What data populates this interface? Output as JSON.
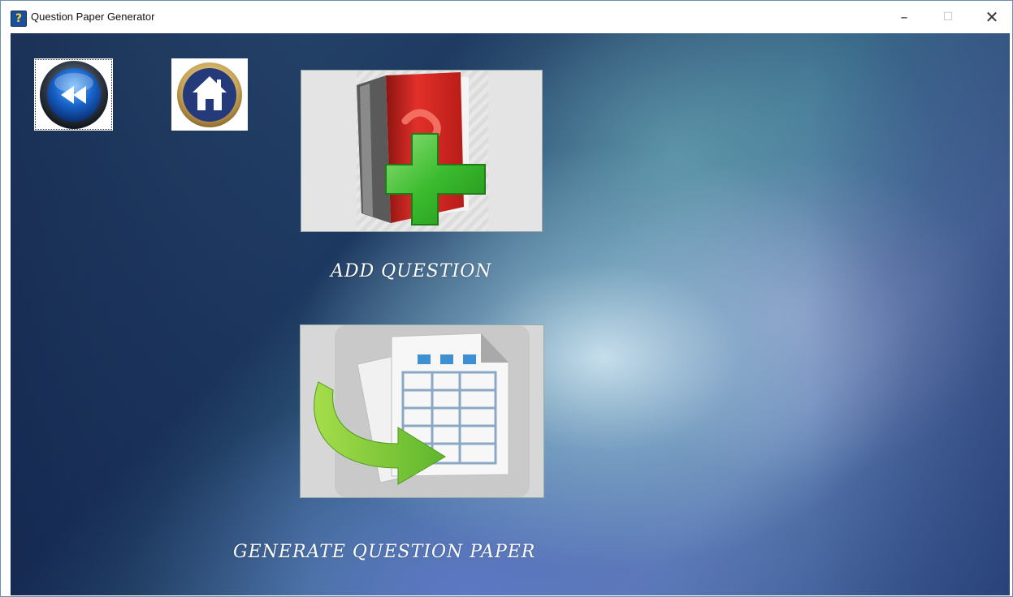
{
  "window": {
    "title": "Question Paper Generator",
    "controls": {
      "minimize": "–",
      "maximize": "☐",
      "close": "✕"
    }
  },
  "nav": {
    "back_icon": "rewind-icon",
    "home_icon": "home-icon"
  },
  "actions": {
    "add_question": {
      "label": "ADD QUESTION",
      "icon": "book-plus-icon"
    },
    "generate_paper": {
      "label": "GENERATE QUESTION PAPER",
      "icon": "document-table-arrow-icon"
    }
  },
  "colors": {
    "label_text": "#ffffff",
    "button_blue": "#1f5fbf",
    "book_red": "#d82a22",
    "plus_green": "#36b82f",
    "arrow_green": "#7cc93a"
  }
}
